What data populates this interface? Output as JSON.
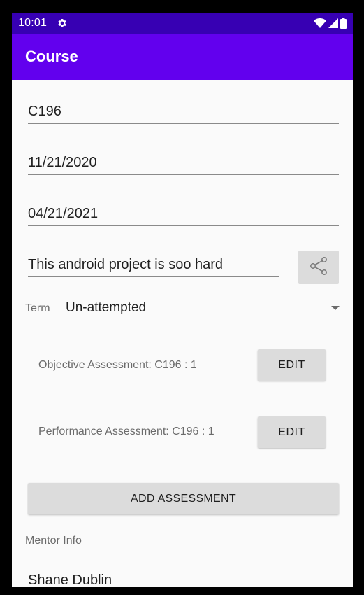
{
  "status_bar": {
    "time": "10:01",
    "icons": [
      "gear-icon",
      "wifi-icon",
      "signal-icon",
      "battery-icon"
    ]
  },
  "app_bar": {
    "title": "Course"
  },
  "form": {
    "course_title": "C196",
    "start_date": "11/21/2020",
    "end_date": "04/21/2021",
    "note": "This android project is soo hard",
    "share_icon": "share-icon"
  },
  "term": {
    "label": "Term",
    "value": "Un-attempted"
  },
  "assessments": [
    {
      "label": "Objective Assessment: C196 : 1",
      "button": "EDIT"
    },
    {
      "label": "Performance Assessment: C196 : 1",
      "button": "EDIT"
    }
  ],
  "add_assessment": {
    "label": "ADD ASSESSMENT"
  },
  "mentor": {
    "label": "Mentor Info",
    "name": "Shane Dublin"
  },
  "colors": {
    "status_bar": "#3700b3",
    "app_bar": "#6200ee",
    "background": "#fafafa",
    "button": "#dcdcdc"
  }
}
